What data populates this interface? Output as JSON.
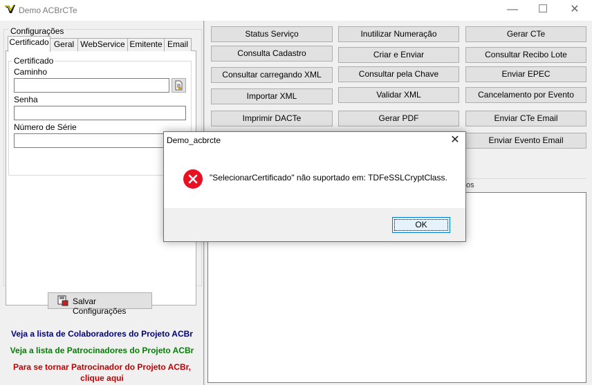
{
  "window": {
    "title": "Demo ACBrCTe",
    "minimize_glyph": "—",
    "maximize_glyph": "☐",
    "close_glyph": "✕"
  },
  "config": {
    "group_label": "Configurações",
    "tabs": [
      "Certificado",
      "Geral",
      "WebService",
      "Emitente",
      "Email"
    ],
    "active_tab": "Certificado",
    "cert_group_label": "Certificado",
    "caminho_label": "Caminho",
    "caminho_value": "",
    "senha_label": "Senha",
    "senha_value": "",
    "serie_label": "Número de Série",
    "serie_value": "",
    "save_label": "Salvar Configurações"
  },
  "promo": {
    "colaboradores": "Veja a lista de Colaboradores do Projeto ACBr",
    "patrocinadores": "Veja a lista de Patrocinadores do Projeto ACBr",
    "patrocinador_line1": "Para se tornar Patrocinador do Projeto ACBr,",
    "patrocinador_line2": "clique aqui",
    "colors": {
      "colaboradores": "#000080",
      "patrocinadores": "#008000",
      "patrocinador": "#c00000"
    }
  },
  "actions": {
    "status_servico": "Status Serviço",
    "inutilizar": "Inutilizar Numeração",
    "gerar_cte": "Gerar CTe",
    "consulta_cadastro": "Consulta Cadastro",
    "criar_enviar": "Criar e Enviar",
    "consultar_recibo": "Consultar Recibo Lote",
    "consultar_xml": "Consultar carregando XML",
    "consultar_chave": "Consultar pela Chave",
    "enviar_epec": "Enviar EPEC",
    "importar_xml": "Importar XML",
    "validar_xml": "Validar XML",
    "cancelamento": "Cancelamento por Evento",
    "imprimir_dacte": "Imprimir DACTe",
    "gerar_pdf": "Gerar PDF",
    "enviar_email": "Enviar CTe Email",
    "enviar_evento_email": "Enviar Evento Email"
  },
  "log": {
    "tab_fragment": "os"
  },
  "dialog": {
    "title": "Demo_acbrcte",
    "message": "\"SelecionarCertificado\" não suportado em: TDFeSSLCryptClass.",
    "ok_label": "OK",
    "icon": "error-icon",
    "icon_color": "#e81123"
  }
}
